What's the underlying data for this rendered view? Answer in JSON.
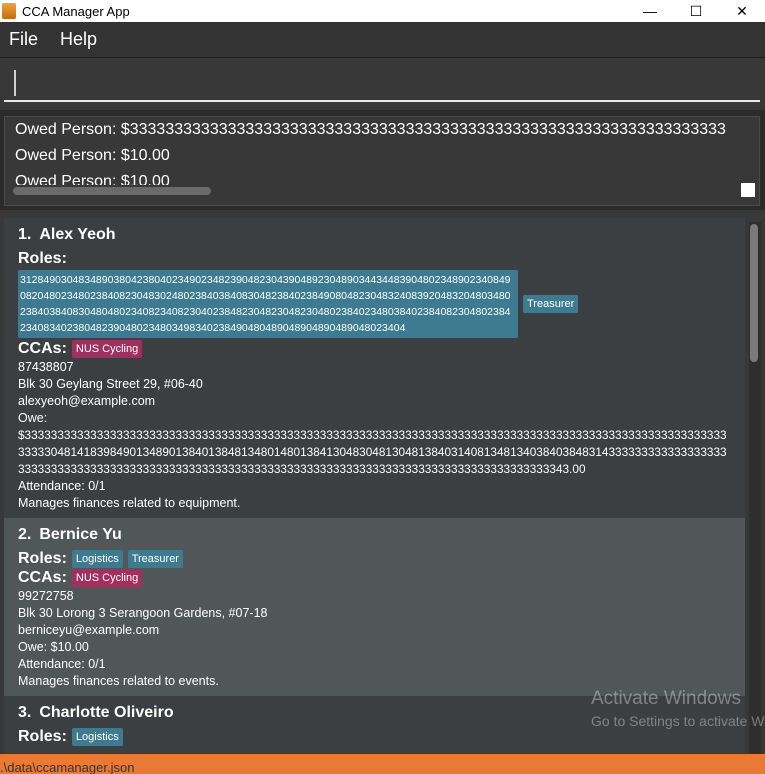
{
  "window": {
    "title": "CCA Manager App",
    "controls": {
      "minimize": "—",
      "maximize": "☐",
      "close": "✕"
    }
  },
  "menu": {
    "items": [
      "File",
      "Help"
    ]
  },
  "command_box": {
    "value": "",
    "placeholder": ""
  },
  "result_display": {
    "lines": [
      "Owed Person: $3333333333333333333333333333333333333333333333333333333333333333333",
      "Owed Person: $10.00",
      "Owed Person: $10.00"
    ]
  },
  "persons": [
    {
      "index": "1.",
      "name": "Alex Yeoh",
      "roles_label": "Roles:",
      "roles": [
        "312849030483489038042380402349023482390482304390489230489034434483904802348902340849082048023480238408230483024802384038408304823840238490804823048324083920483204803480238403840830480480234082340823040238482304823048230480238402348038402384082304802384234083402380482390480234803498340238490480489048904890489048023404",
        "Treasurer"
      ],
      "ccas_label": "CCAs:",
      "ccas": [
        "NUS Cycling"
      ],
      "phone": "87438807",
      "address": "Blk 30 Geylang Street 29, #06-40",
      "email": "alexyeoh@example.com",
      "owe_label": "Owe:",
      "owe": "$33333333333333333333333333333333333333333333333333333333333333333333333333333333333333333333333333333333333333330481418398490134890138401384813480148013841304830481304813840314081348134038403848314333333333333333333333333333333333333333333333333333333333333333333333333333333333333333333333333333343.00",
      "attendance": "Attendance: 0/1",
      "remark": "Manages finances related to equipment."
    },
    {
      "index": "2.",
      "name": "Bernice Yu",
      "roles_label": "Roles:",
      "roles": [
        "Logistics",
        "Treasurer"
      ],
      "ccas_label": "CCAs:",
      "ccas": [
        "NUS Cycling"
      ],
      "phone": "99272758",
      "address": "Blk 30 Lorong 3 Serangoon Gardens, #07-18",
      "email": "berniceyu@example.com",
      "owe": "Owe: $10.00",
      "attendance": "Attendance: 0/1",
      "remark": "Manages finances related to events."
    },
    {
      "index": "3.",
      "name": "Charlotte Oliveiro",
      "roles_label": "Roles:",
      "roles": [
        "Logistics"
      ]
    }
  ],
  "watermark": {
    "line1": "Activate Windows",
    "line2": "Go to Settings to activate W"
  },
  "status_bar": {
    "path": ".\\data\\ccamanager.json"
  },
  "colors": {
    "role_tag": "#3e7b91",
    "cca_tag": "#a0305d",
    "status_bar": "#e97a35"
  }
}
